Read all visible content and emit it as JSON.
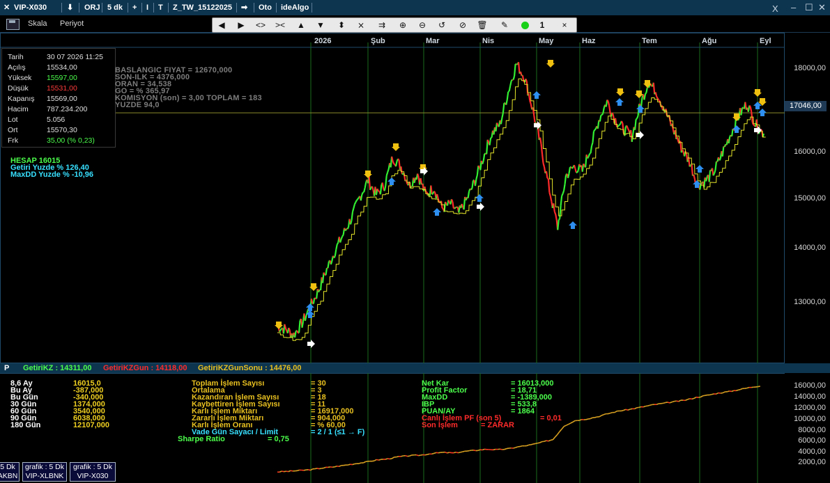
{
  "topbar": {
    "close_glyph": "✕",
    "symbol": "VIP-X030",
    "download_glyph": "⬇",
    "orj": "ORJ",
    "period": "5 dk",
    "plus": "+",
    "bar_glyph": "I",
    "t_glyph": "T",
    "template": "Z_TW_15122025",
    "arrow_glyph": "➡",
    "oto": "Oto",
    "idealgo": "ideAlgo",
    "win_close": "X",
    "win_min": "–",
    "win_max": "☐",
    "win_x": "✕"
  },
  "subbar": {
    "skala": "Skala",
    "periyot": "Periyot"
  },
  "toolbar": {
    "line_count": "1",
    "close": "×"
  },
  "months": [
    "2026",
    "Şub",
    "Mar",
    "Nis",
    "May",
    "Haz",
    "Tem",
    "Ağu",
    "Eyl"
  ],
  "price_axis": [
    "18000,00",
    "17000,00",
    "16000,00",
    "15000,00",
    "14000,00",
    "13000,00"
  ],
  "current_price": "17046,00",
  "info": {
    "rows": [
      {
        "label": "Tarih",
        "value": "30 07 2026 11:25",
        "color": "#e0e0e0"
      },
      {
        "label": "Açılış",
        "value": "15534,00",
        "color": "#e0e0e0"
      },
      {
        "label": "Yüksek",
        "value": "15597,00",
        "color": "#4cff4c"
      },
      {
        "label": "Düşük",
        "value": "15531,00",
        "color": "#ff3b3b"
      },
      {
        "label": "Kapanış",
        "value": "15569,00",
        "color": "#e0e0e0"
      },
      {
        "label": "Hacim",
        "value": "787.234.200",
        "color": "#e0e0e0"
      },
      {
        "label": "Lot",
        "value": "5.056",
        "color": "#e0e0e0"
      },
      {
        "label": "Ort",
        "value": "15570,30",
        "color": "#e0e0e0"
      },
      {
        "label": "Frk",
        "value": "35,00 (% 0,23)",
        "color": "#4cff4c"
      }
    ]
  },
  "strategy_stats": [
    "BASLANGIC FIYAT = 12670,000",
    "SON-ILK = 4376,000",
    "ORAN = 34,538",
    "GO = %  365,97",
    "KOMISYON (son) =    3,00   TOPLAM = 183",
    "YUZDE  94,0"
  ],
  "hesap": {
    "line1": "HESAP  16015",
    "line2": "Getiri Yuzde  % 126,40",
    "line3": "MaxDD Yuzde   % -10,96"
  },
  "pane_bar": {
    "p": "P",
    "getirikz": "GetiriKZ : 14311,00",
    "getirikzgun": "GetiriKZGun : 14118,00",
    "getirikzgunsonu": "GetiriKZGunSonu : 14476,00"
  },
  "periods": [
    {
      "label": "8,6 Ay",
      "value": "16015,0"
    },
    {
      "label": "Bu Ay",
      "value": "-387,000"
    },
    {
      "label": "Bu Gün",
      "value": "-340,000"
    },
    {
      "label": "30 Gün",
      "value": "1374,000"
    },
    {
      "label": "60 Gün",
      "value": "3540,000"
    },
    {
      "label": "90 Gün",
      "value": "6038,000"
    },
    {
      "label": "180 Gün",
      "value": "12107,000"
    }
  ],
  "trade_stats": [
    {
      "label": "Toplam İşlem Sayısı",
      "value": "= 30"
    },
    {
      "label": "Ortalama",
      "value": "= 3"
    },
    {
      "label": "Kazandıran İşlem Sayısı",
      "value": "= 18"
    },
    {
      "label": "Kaybettiren İşlem Sayısı",
      "value": "= 11"
    },
    {
      "label": "Karlı İşlem Miktarı",
      "value": "= 16917,000"
    },
    {
      "label": "Zararlı İşlem Miktarı",
      "value": "= 904,000"
    },
    {
      "label": "Karlı İşlem Oranı",
      "value": "= % 60,00"
    }
  ],
  "vade": {
    "label": "Vade Gün Sayacı / Limit",
    "value": "= 2 / 1   (≤1 → F)"
  },
  "sharpe": {
    "label": "Sharpe Ratio",
    "value": "=  0,75"
  },
  "perf_stats": [
    {
      "label": "Net Kar",
      "value": "= 16013,000",
      "color": "#4cff4c"
    },
    {
      "label": "Profit Factor",
      "value": "= 18,71",
      "color": "#4cff4c"
    },
    {
      "label": "MaxDD",
      "value": "= -1389,000",
      "color": "#4cff4c"
    },
    {
      "label": "IBP",
      "value": "= 533,8",
      "color": "#4cff4c"
    },
    {
      "label": "PUAN/AY",
      "value": "= 1864",
      "color": "#4cff4c"
    },
    {
      "label": "Canlı İşlem PF (son 5)",
      "value": "= 0,01",
      "color": "#ff2b2b"
    },
    {
      "label": "Son İşlem",
      "value": "= ZARAR",
      "color": "#ff2b2b"
    }
  ],
  "equity_axis": [
    "16000,00",
    "14000,00",
    "12000,00",
    "10000,00",
    "8000,00",
    "6000,00",
    "4000,00",
    "2000,00"
  ],
  "tabs": [
    {
      "line1": "5 Dk",
      "line2": "AKBN"
    },
    {
      "line1": "grafik : 5 Dk",
      "line2": "VIP-XLBNK"
    },
    {
      "line1": "grafik : 5 Dk",
      "line2": "VIP-X030"
    }
  ],
  "chart_data": {
    "type": "line",
    "title": "",
    "y_axis_ticks": [
      18000,
      17000,
      16000,
      15000,
      14000,
      13000
    ],
    "x_axis_ticks": [
      "2026",
      "Şub",
      "Mar",
      "Nis",
      "May",
      "Haz",
      "Tem",
      "Ağu",
      "Eyl"
    ],
    "series": [
      {
        "values": [
          12480,
          12420,
          12300,
          12550,
          12900,
          13250,
          13700,
          14100,
          14450,
          14800,
          15250,
          15600,
          15300,
          15500,
          16100,
          15900,
          15500,
          15750,
          15300,
          15450,
          15000,
          15100,
          14900,
          15200,
          15600,
          16100,
          16600,
          16800,
          17500,
          18100,
          17800,
          17100,
          16300,
          15400,
          14600,
          15700,
          15900,
          15800,
          16300,
          16900,
          17300,
          16900,
          16700,
          16550,
          17200,
          17700,
          17500,
          17100,
          16700,
          16300,
          16000,
          15500,
          15600,
          15800,
          16200,
          16600,
          17000,
          17250,
          16800,
          16600
        ]
      }
    ],
    "equity_series": {
      "name": "GetiriKZ",
      "values": [
        0,
        100,
        250,
        400,
        700,
        900,
        1200,
        1500,
        1800,
        2200,
        2400,
        2800,
        3000,
        3100,
        3400,
        3600,
        3500,
        3800,
        4000,
        4200,
        4100,
        4300,
        4700,
        5000,
        5500,
        6000,
        8500,
        9500,
        9800,
        10200,
        10800,
        11300,
        11600,
        12000,
        12400,
        12700,
        13000,
        13300,
        13800,
        14200,
        14600,
        14900,
        15300,
        15700,
        16013
      ]
    }
  }
}
